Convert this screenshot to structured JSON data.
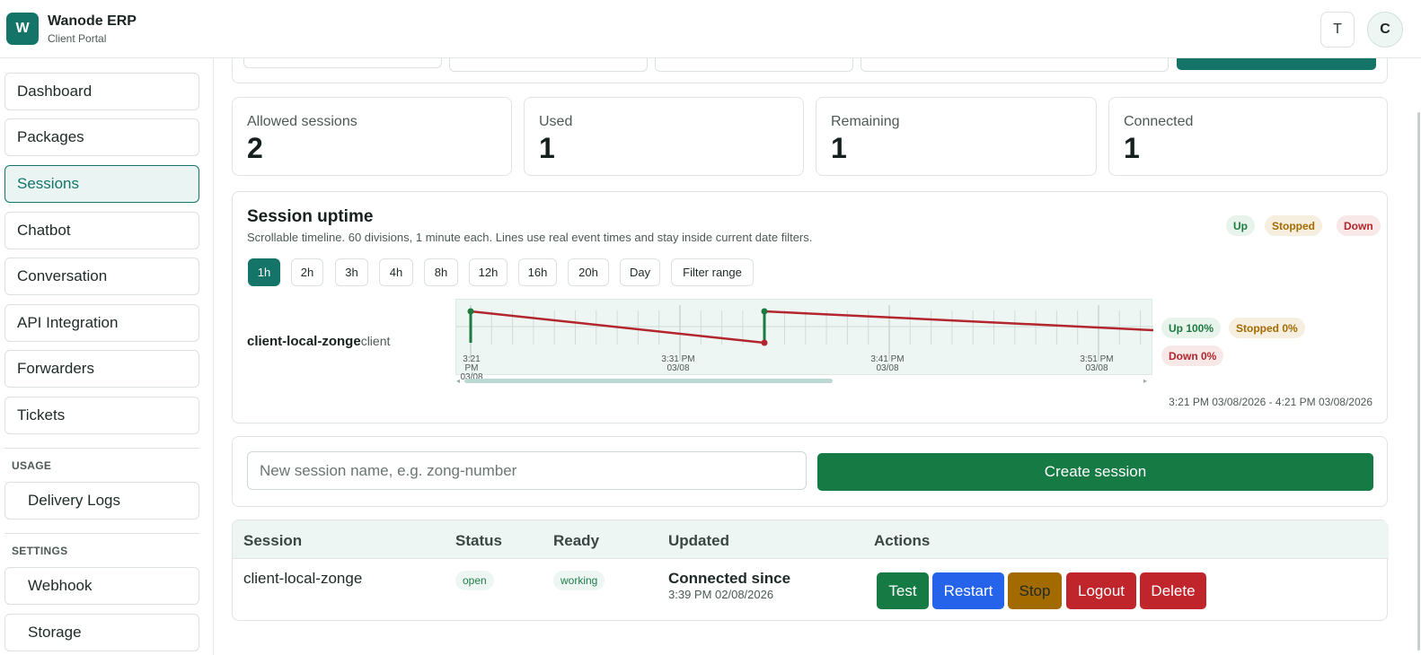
{
  "app": {
    "title": "Wanode ERP",
    "subtitle": "Client Portal",
    "logo_letter": "W",
    "user_initial_t": "T",
    "user_avatar": "C"
  },
  "sidebar": {
    "items": [
      {
        "label": "Dashboard"
      },
      {
        "label": "Packages"
      },
      {
        "label": "Sessions",
        "active": true
      },
      {
        "label": "Chatbot"
      },
      {
        "label": "Conversation"
      },
      {
        "label": "API Integration"
      },
      {
        "label": "Forwarders"
      },
      {
        "label": "Tickets"
      }
    ],
    "usage_heading": "USAGE",
    "usage_items": [
      {
        "label": "Delivery Logs"
      }
    ],
    "settings_heading": "SETTINGS",
    "settings_items": [
      {
        "label": "Webhook"
      },
      {
        "label": "Storage"
      }
    ]
  },
  "stats": [
    {
      "label": "Allowed sessions",
      "value": "2"
    },
    {
      "label": "Used",
      "value": "1"
    },
    {
      "label": "Remaining",
      "value": "1"
    },
    {
      "label": "Connected",
      "value": "1"
    }
  ],
  "uptime": {
    "title": "Session uptime",
    "subtitle": "Scrollable timeline. 60 divisions, 1 minute each. Lines use real event times and stay inside current date filters.",
    "legend": [
      "Up",
      "Stopped",
      "Down"
    ],
    "ranges": [
      "1h",
      "2h",
      "3h",
      "4h",
      "8h",
      "12h",
      "16h",
      "20h",
      "Day",
      "Filter range"
    ],
    "active_range": "1h",
    "session_name": "client-local-zonge",
    "session_type": "client",
    "ticks": [
      {
        "time": "3:21 PM",
        "date": "03/08"
      },
      {
        "time": "3:31 PM",
        "date": "03/08"
      },
      {
        "time": "3:41 PM",
        "date": "03/08"
      },
      {
        "time": "3:51 PM",
        "date": "03/08"
      }
    ],
    "summary": {
      "up": "Up 100%",
      "stopped": "Stopped 0%",
      "down": "Down 0%"
    },
    "range_text": "3:21 PM 03/08/2026 - 4:21 PM 03/08/2026",
    "colors": {
      "up": "#1b7a3e",
      "down": "#b3262d",
      "stopped": "#a36a00"
    }
  },
  "create": {
    "placeholder": "New session name, e.g. zong-number",
    "button": "Create session"
  },
  "table": {
    "headers": [
      "Session",
      "Status",
      "Ready",
      "Updated",
      "Actions"
    ],
    "rows": [
      {
        "session": "client-local-zonge",
        "status": "open",
        "ready": "working",
        "updated_title": "Connected since",
        "updated_time": "3:39 PM 02/08/2026",
        "actions": [
          "Test",
          "Restart",
          "Stop",
          "Logout",
          "Delete"
        ]
      }
    ]
  }
}
